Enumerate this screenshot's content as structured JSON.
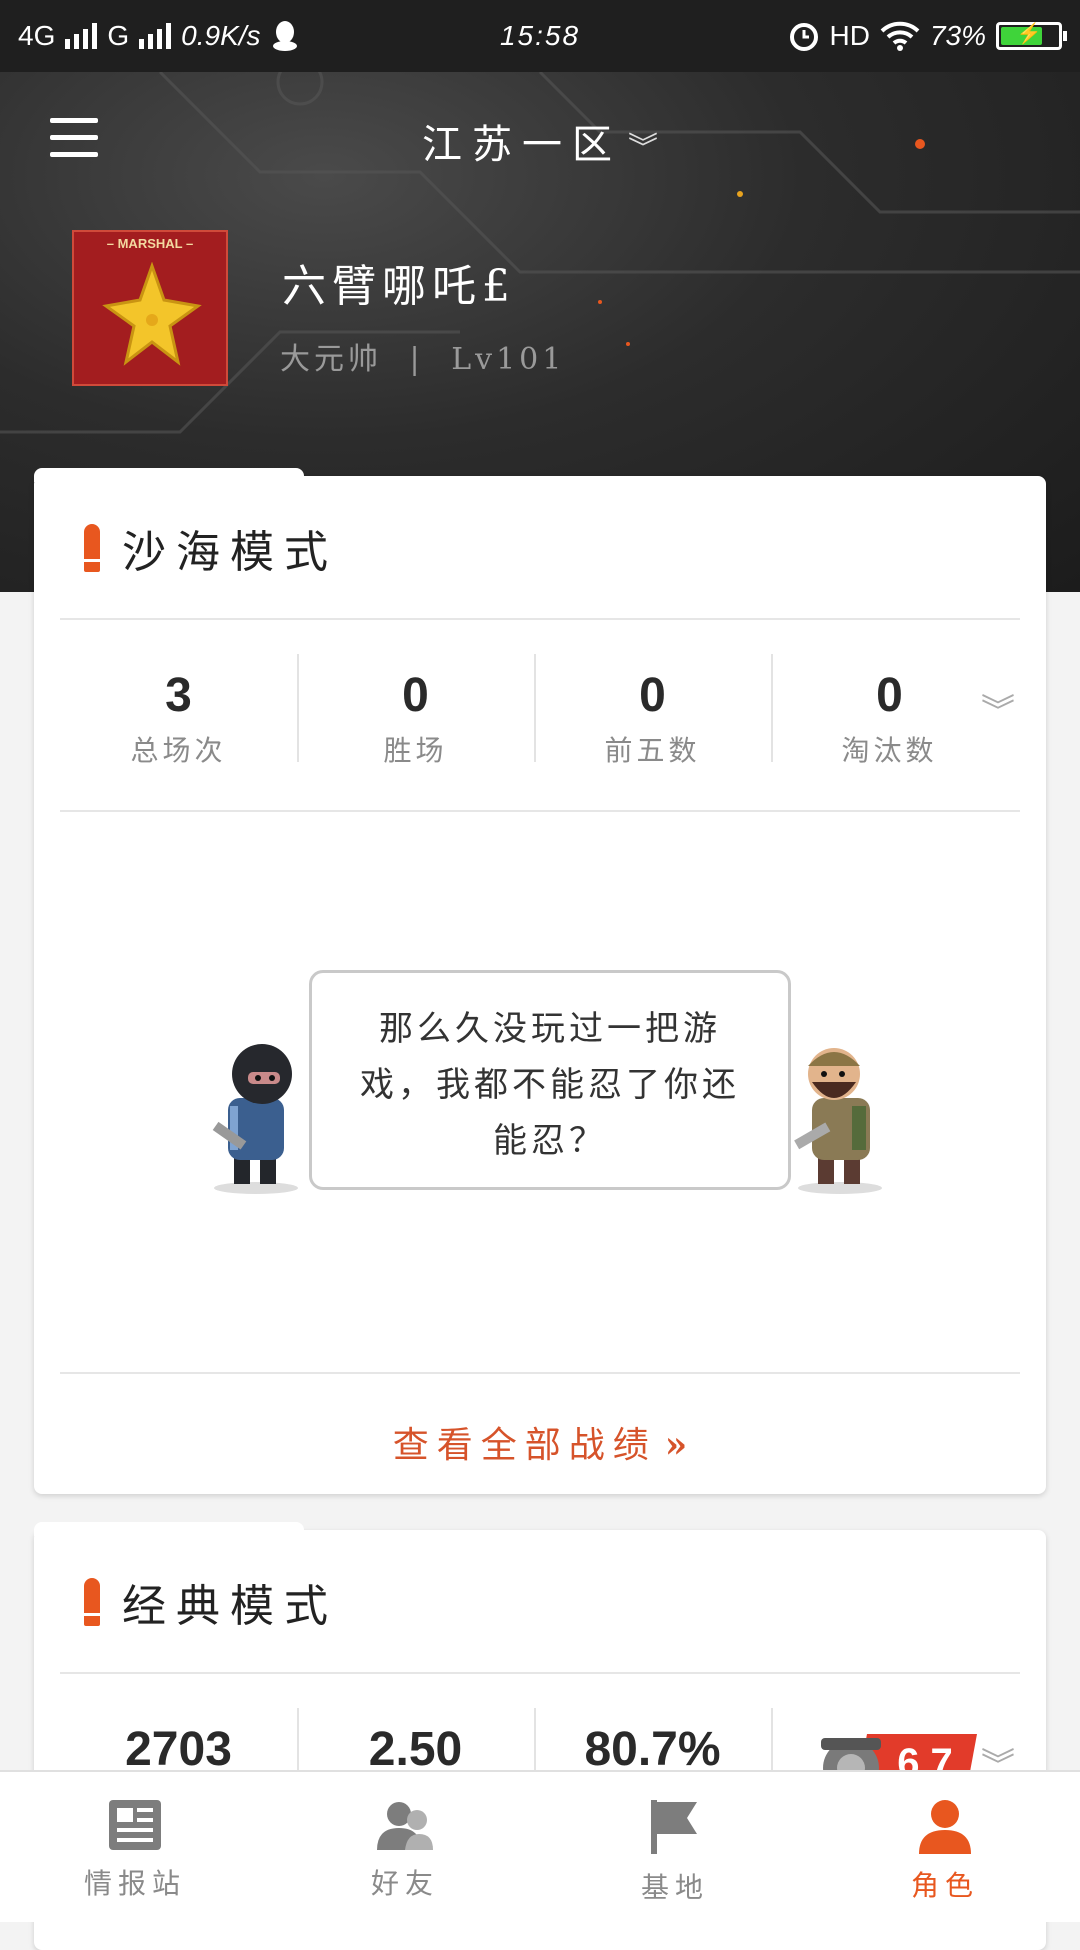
{
  "status_bar": {
    "network1": "4G",
    "network2": "G",
    "speed": "0.9K/s",
    "time": "15:58",
    "hd": "HD",
    "battery": "73%",
    "battery_level": 0.73
  },
  "header": {
    "server": "江苏一区",
    "rank_badge_text": "– MARSHAL –",
    "player_name": "六臂哪吒£",
    "player_rank": "大元帅",
    "separator": "|",
    "player_level": "Lv101"
  },
  "desert_mode": {
    "title": "沙海模式",
    "stats": [
      {
        "value": "3",
        "label": "总场次"
      },
      {
        "value": "0",
        "label": "胜场"
      },
      {
        "value": "0",
        "label": "前五数"
      },
      {
        "value": "0",
        "label": "淘汰数"
      }
    ],
    "empty_message": "那么久没玩过一把游戏，我都不能忍了你还能忍？",
    "view_all": "查看全部战绩",
    "view_all_arrow": "»"
  },
  "classic_mode": {
    "title": "经典模式",
    "stats": [
      {
        "value": "2703"
      },
      {
        "value": "2.50"
      },
      {
        "value": "80.7%"
      }
    ],
    "rating": "6.7"
  },
  "bottom_nav": [
    {
      "label": "情报站",
      "icon": "news-icon"
    },
    {
      "label": "好友",
      "icon": "friends-icon"
    },
    {
      "label": "基地",
      "icon": "flag-icon"
    },
    {
      "label": "角色",
      "icon": "profile-icon",
      "active": true
    }
  ],
  "colors": {
    "accent": "#e8571f",
    "link": "#d6532a",
    "header_bg": "#2c2c2c"
  }
}
